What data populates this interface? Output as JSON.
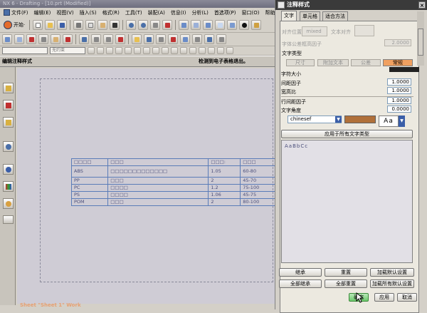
{
  "app": {
    "window_title": "NX 6 - Drafting - [10.prt (Modified)]"
  },
  "menu": {
    "items": [
      {
        "label": "文件(F)",
        "key": "file"
      },
      {
        "label": "编辑(E)",
        "key": "edit"
      },
      {
        "label": "视图(V)",
        "key": "view"
      },
      {
        "label": "插入(S)",
        "key": "insert"
      },
      {
        "label": "格式(R)",
        "key": "format"
      },
      {
        "label": "工具(T)",
        "key": "tools"
      },
      {
        "label": "装配(A)",
        "key": "assembly"
      },
      {
        "label": "信息(I)",
        "key": "info"
      },
      {
        "label": "分析(L)",
        "key": "analysis"
      },
      {
        "label": "首选项(P)",
        "key": "prefs"
      },
      {
        "label": "窗口(O)",
        "key": "window"
      },
      {
        "label": "帮助(H)",
        "key": "help"
      }
    ],
    "start_label": "开始·"
  },
  "toolbar": {
    "dropdown1": "",
    "dropdown2": "无约束"
  },
  "hint": {
    "left": "编辑注释样式",
    "right": "检测到电子表格退出。"
  },
  "status": {
    "sheet": "Sheet \"Sheet 1\" Work"
  },
  "table": {
    "rows": [
      [
        "□□□□",
        "□□□",
        "□□□:",
        "□□□"
      ],
      [
        "ABS",
        "□□□□□□□□□□□□□",
        "1.05",
        "60-80"
      ],
      [
        "PP",
        "□□□",
        "2",
        "45-70"
      ],
      [
        "PC",
        "□□□□",
        "1.2",
        "75-100"
      ],
      [
        "PS",
        "□□□□",
        "1.06",
        "45-75"
      ],
      [
        "POM",
        "□□□",
        "2",
        "80-100"
      ]
    ]
  },
  "dialog": {
    "title": "注释样式",
    "close": "×",
    "tabs": [
      "文字",
      "单元格",
      "适合方法"
    ],
    "text_position_label": "对齐位置",
    "text_position_value": "mixed",
    "text_justify_label": "文本对齐",
    "char_size_factor_label": "字体公差框高因子",
    "char_size_factor_value": "2.0000",
    "text_type_label": "文字类型",
    "subtabs": [
      "尺寸",
      "附加文本",
      "公差",
      "常规"
    ],
    "char_size_label": "字符大小",
    "char_size_value": "",
    "spacing_factor_label": "间距因子",
    "spacing_factor_value": "1.0000",
    "aspect_ratio_label": "宽高比",
    "aspect_ratio_value": "1.0000",
    "line_spacing_label": "行间距因子",
    "line_spacing_value": "1.0000",
    "text_angle_label": "文字角度",
    "text_angle_value": "0.0000",
    "font_value": "chinesef",
    "font_preview": "Aa",
    "apply_all_label": "应用于所有文字类型",
    "preview_text": "AaBbCc",
    "btn_inherit": "继承",
    "btn_reset": "重置",
    "btn_load_default": "加载默认设置",
    "btn_inherit_all": "全部继承",
    "btn_reset_all": "全部重置",
    "btn_load_all_default": "加载所有默认设置",
    "btn_ok": "确定",
    "btn_apply": "应用",
    "btn_cancel": "取消",
    "color_swatch": "#b0703a",
    "accent": "#f0a060"
  }
}
